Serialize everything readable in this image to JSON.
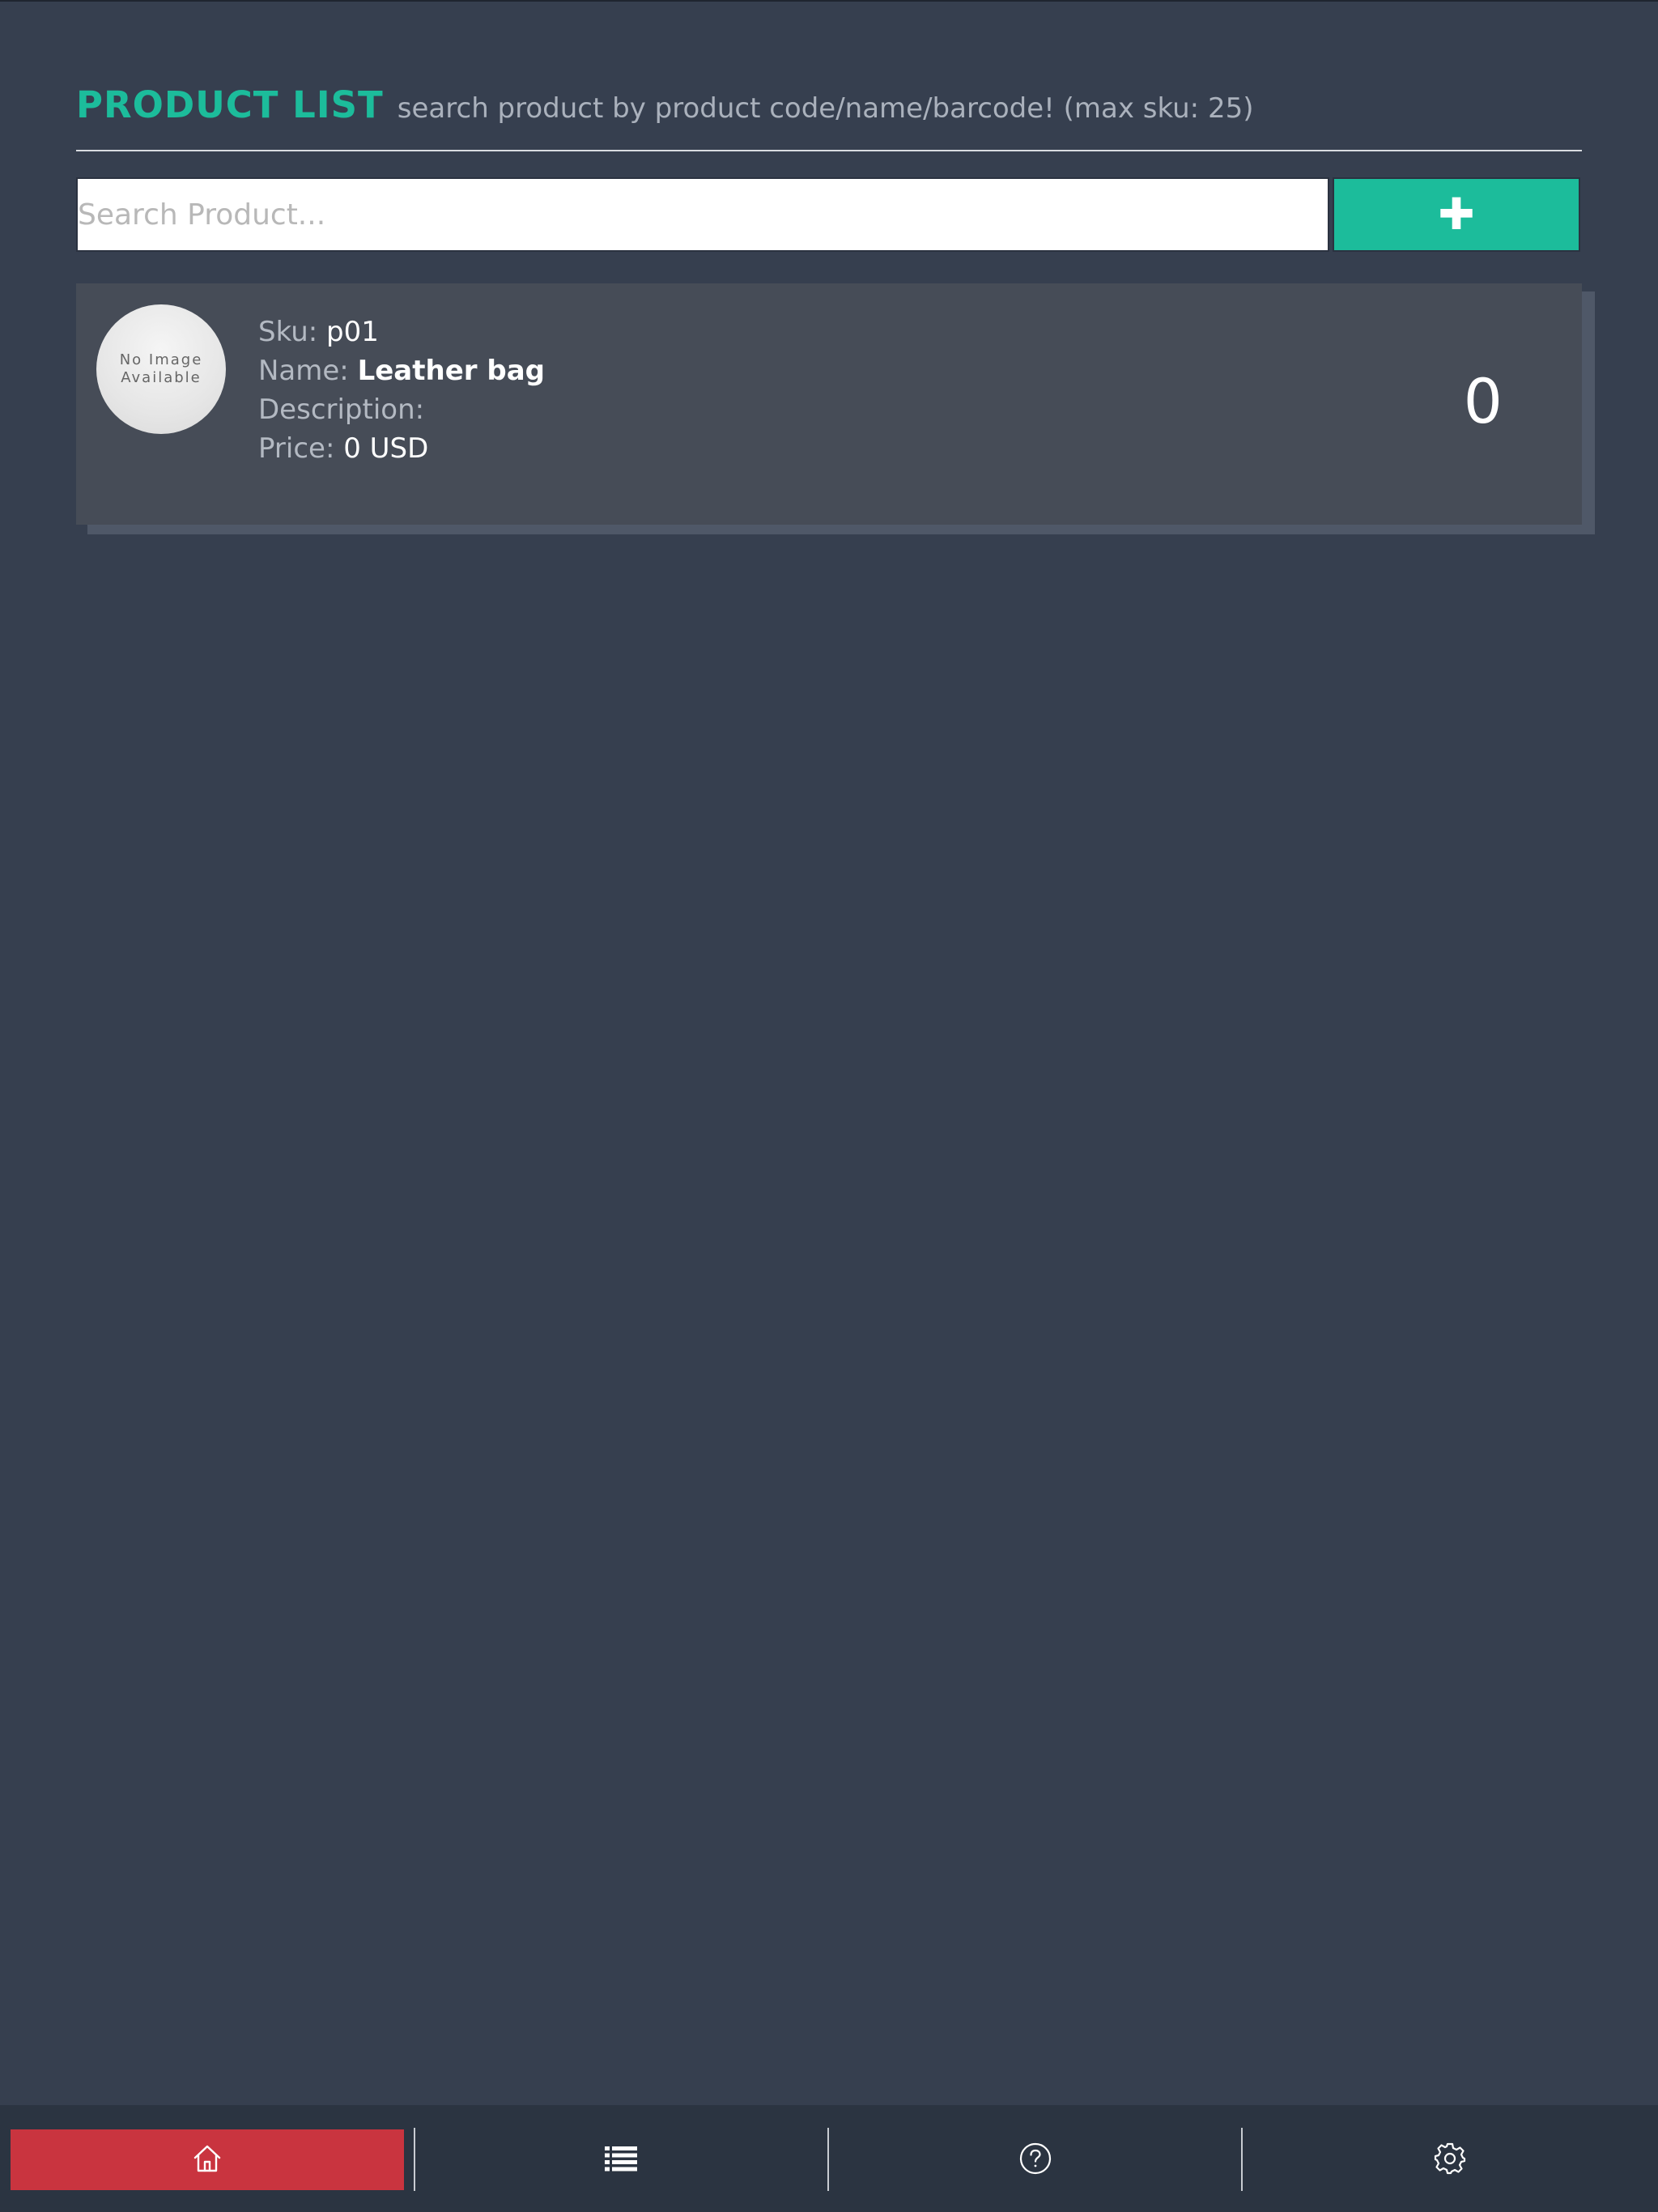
{
  "header": {
    "title": "PRODUCT LIST",
    "subtitle": "search product by product code/name/barcode! (max sku: 25)"
  },
  "search": {
    "placeholder": "Search Product...",
    "add_icon": "plus-icon"
  },
  "products": [
    {
      "image_text": "No Image Available",
      "sku_label": "Sku:",
      "sku": "p01",
      "name_label": "Name:",
      "name": "Leather bag",
      "description_label": "Description:",
      "description": "",
      "price_label": "Price:",
      "price": "0 USD",
      "quantity": "0"
    }
  ],
  "nav": {
    "items": [
      {
        "icon": "home-icon",
        "active": true
      },
      {
        "icon": "list-icon",
        "active": false
      },
      {
        "icon": "help-icon",
        "active": false
      },
      {
        "icon": "settings-icon",
        "active": false
      }
    ]
  },
  "colors": {
    "background": "#363f4f",
    "accent": "#1cbc9b",
    "active_nav": "#c9343f",
    "card": "#464c57"
  }
}
